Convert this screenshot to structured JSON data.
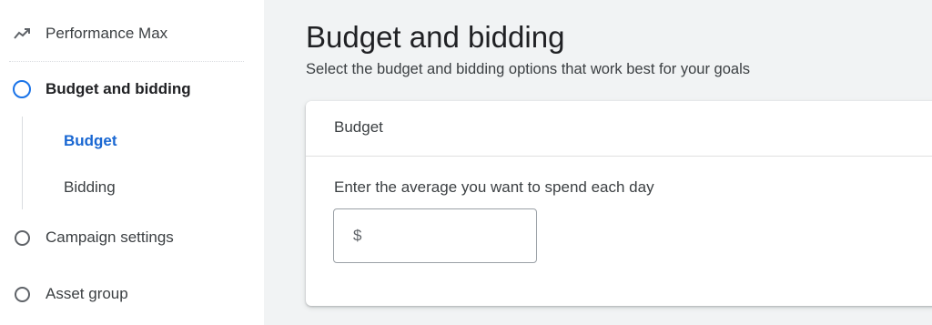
{
  "sidebar": {
    "items": [
      {
        "label": "Performance Max",
        "icon": "trending-icon"
      },
      {
        "label": "Budget and bidding",
        "icon": "circle-icon",
        "active": true
      },
      {
        "label": "Campaign settings",
        "icon": "circle-icon"
      },
      {
        "label": "Asset group",
        "icon": "circle-icon"
      }
    ],
    "subitems": [
      {
        "label": "Budget",
        "active": true
      },
      {
        "label": "Bidding"
      }
    ]
  },
  "main": {
    "title": "Budget and bidding",
    "subtitle": "Select the budget and bidding options that work best for your goals",
    "card": {
      "header": "Budget",
      "field_label": "Enter the average you want to spend each day",
      "currency_prefix": "$",
      "input_value": ""
    }
  },
  "colors": {
    "accent": "#1a73e8",
    "active_text": "#1967d2",
    "main_background": "#f1f3f4"
  }
}
